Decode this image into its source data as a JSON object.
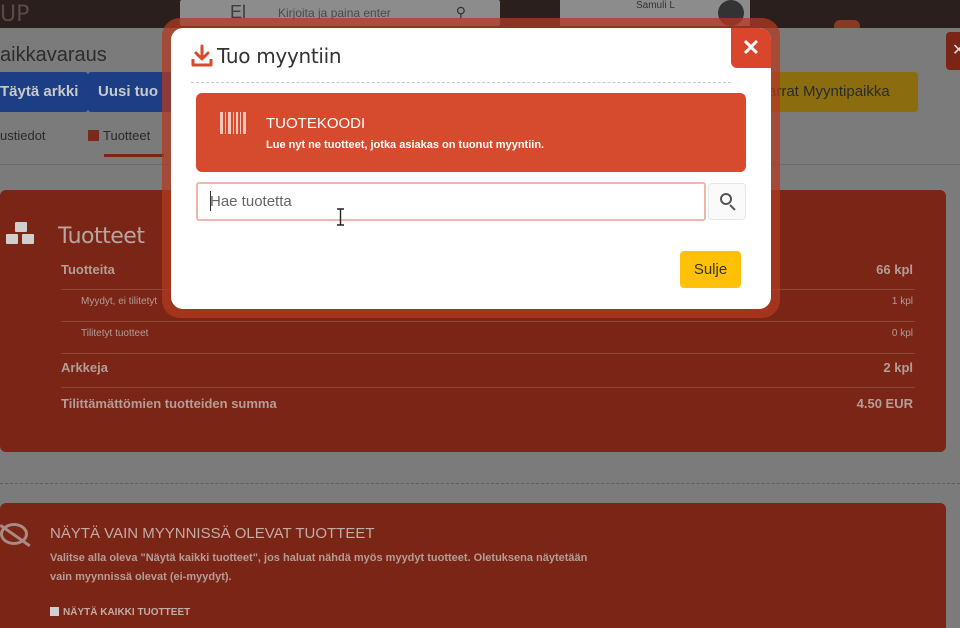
{
  "background": {
    "topbar": {
      "logo": "UP",
      "search_prefix": "El",
      "search_placeholder": "Kirjoita ja paina enter",
      "user_name": "Samuli L"
    },
    "page_title": "aikkavaraus",
    "buttons": {
      "fill_sheet": "Täytä arkki",
      "new": "Uusi tuo",
      "stalls": "arrat Myyntipaikka"
    },
    "tabs": {
      "info": "ustiedot",
      "products": "Tuotteet"
    },
    "products_panel": {
      "title": "Tuotteet",
      "rows": [
        {
          "label": "Tuotteita",
          "value": "66 kpl"
        },
        {
          "label": "Myydyt, ei tilitetyt",
          "value": "1 kpl"
        },
        {
          "label": "Tilitetyt tuotteet",
          "value": "0 kpl"
        },
        {
          "label": "Arkkeja",
          "value": "2 kpl"
        },
        {
          "label": "Tilittämättömien tuotteiden summa",
          "value": "4.50 EUR"
        }
      ]
    },
    "filter_panel": {
      "title": "NÄYTÄ VAIN MYYNNISSÄ OLEVAT TUOTTEET",
      "description": "Valitse alla oleva \"Näytä kaikki tuotteet\", jos haluat nähdä myös myydyt tuotteet. Oletuksena näytetään vain myynnissä olevat (ei-myydyt).",
      "checkbox_label": "NÄYTÄ KAIKKI TUOTTEET"
    }
  },
  "modal": {
    "title": "Tuo myyntiin",
    "close_symbol": "✕",
    "barcode": {
      "title": "TUOTEKOODI",
      "description": "Lue nyt ne tuotteet, jotka asiakas on tuonut myyntiin."
    },
    "search": {
      "placeholder": "Hae tuotetta",
      "value": ""
    },
    "close_button": "Sulje"
  },
  "colors": {
    "accent": "#d64a2d",
    "close_button": "#ffc107",
    "overlay_panel": "#7a2515"
  },
  "icons": {
    "header": "download-icon",
    "barcode": "barcode-icon",
    "search": "search-icon",
    "close": "close-icon"
  }
}
